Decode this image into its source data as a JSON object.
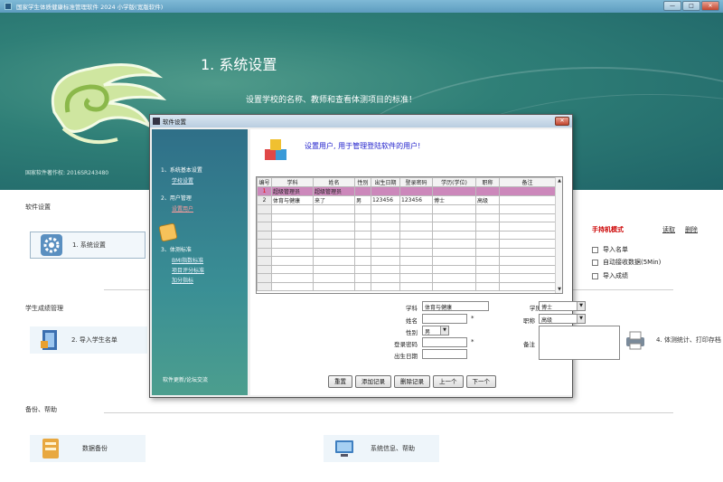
{
  "window": {
    "title": "国家学生体质健康标准管理软件 2024 小学版(宽版软件)",
    "min_label": "—",
    "max_label": "□",
    "close_label": "✕"
  },
  "banner": {
    "title": "1. 系统设置",
    "subtitle": "设置学校的名称、教师和查看体测项目的标准！",
    "copyright": "国家软件著作权: 2016SR243480"
  },
  "sections": {
    "settings_label": "软件设置",
    "scores_label": "学生成绩管理",
    "backup_label": "备份、帮助"
  },
  "tiles": {
    "system_settings": "1. 系统设置",
    "import_students": "2. 导入学生名单",
    "stats_print": "4. 体测统计、打印存档",
    "data_backup": "数据备份",
    "sys_info": "系统信息、帮助"
  },
  "right_panel": {
    "handheld_mode": "手持机模式",
    "open_link": "读取",
    "delete_link": "删除",
    "checkboxes": [
      "导入名单",
      "自动接收数据(5Min)",
      "导入成绩"
    ]
  },
  "dialog": {
    "title": "软件设置",
    "heading": "设置用户, 用于管理登陆软件的用户!",
    "close_label": "✕",
    "sidebar": {
      "group1": "1、系统基本设置",
      "group1_item": "学校设置",
      "group2": "2、用户管理",
      "group2_item": "设置用户",
      "group3": "3、体测标准",
      "group3_items": [
        "BMI指数标准",
        "项目评分标准",
        "加分指标"
      ],
      "footer": "软件更新/论坛交流"
    },
    "grid": {
      "headers": [
        "编号",
        "学科",
        "姓名",
        "性别",
        "出生日期",
        "登录密码",
        "学历(学位)",
        "职称",
        "备注"
      ],
      "rows": [
        [
          "1",
          "超级管理员",
          "超级管理员",
          "",
          "",
          "",
          "",
          "",
          ""
        ],
        [
          "2",
          "体育与健康",
          "来了",
          "男",
          "123456",
          "123456",
          "博士",
          "高级",
          ""
        ]
      ]
    },
    "form": {
      "subject_label": "学科",
      "subject_value": "体育与健康",
      "degree_label": "学历(学位)",
      "degree_value": "博士",
      "name_label": "姓名",
      "name_value": "",
      "title_label": "职称",
      "title_value": "高级",
      "gender_label": "性别",
      "gender_value": "男",
      "password_label": "登录密码",
      "password_value": "",
      "remark_label": "备注",
      "birth_label": "出生日期",
      "birth_value": "",
      "required_mark": "*"
    },
    "buttons": [
      "重置",
      "添加记录",
      "删除记录",
      "上一个",
      "下一个"
    ]
  },
  "colors": {
    "banner": "#2f7f77",
    "dialog_sidebar": "#2f6f88",
    "selected_row": "#cc88bb",
    "heading_blue": "#2222cc",
    "handheld_red": "#cc0000"
  }
}
